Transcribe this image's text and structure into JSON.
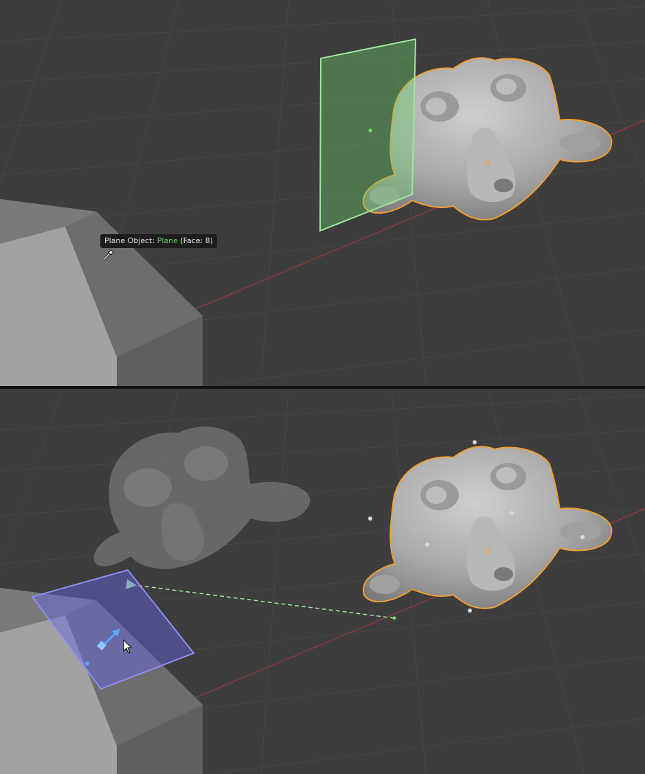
{
  "tooltip": {
    "prefix": "Plane Object: ",
    "object_name": "Plane",
    "suffix": " (Face: 8)"
  },
  "icons": {
    "eyedropper": "eyedropper-icon",
    "cursor": "mouse-pointer-icon",
    "gizmo": "transform-gizmo-icon"
  },
  "colors": {
    "background": "#3d3d3d",
    "grid": "#474747",
    "x_axis": "#8a3a3e",
    "selection_outline": "#f0a030",
    "plane_green": "#7fe07f",
    "plane_blue": "#8f8ff0",
    "snap_line": "#9de89d"
  }
}
